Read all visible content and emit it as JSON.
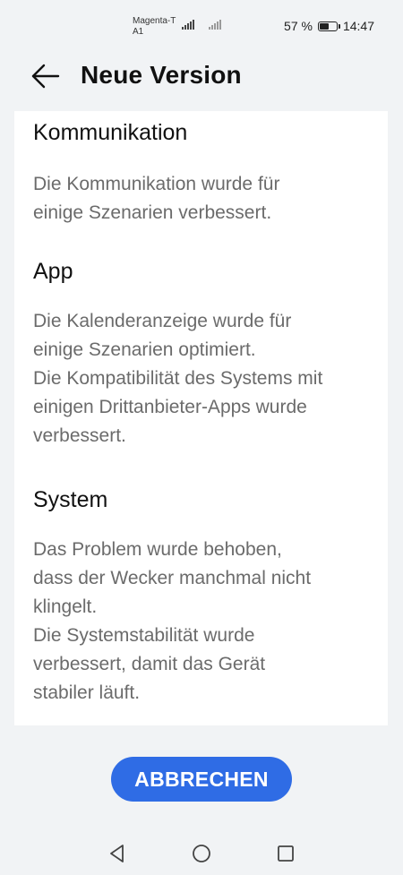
{
  "status_bar": {
    "carrier_line1": "Magenta-T",
    "carrier_line2": "A1",
    "battery_percent": "57 %",
    "battery_level": 0.57,
    "time": "14:47"
  },
  "header": {
    "back_icon": "arrow-left-icon",
    "title": "Neue Version"
  },
  "sections": [
    {
      "title": "Kommunikation",
      "lines": [
        "Die Kommunikation wurde für",
        "einige Szenarien verbessert."
      ]
    },
    {
      "title": "App",
      "lines": [
        "Die Kalenderanzeige wurde für",
        "einige Szenarien optimiert.",
        "Die Kompatibilität des Systems mit",
        "einigen Drittanbieter-Apps wurde",
        "verbessert."
      ]
    },
    {
      "title": "System",
      "lines": [
        "Das Problem wurde behoben,",
        "dass der Wecker manchmal nicht",
        "klingelt.",
        "Die Systemstabilität wurde",
        "verbessert, damit das Gerät",
        "stabiler läuft."
      ]
    }
  ],
  "actions": {
    "cancel_label": "ABBRECHEN"
  },
  "nav_bar": {
    "back_icon": "triangle-back-icon",
    "home_icon": "circle-home-icon",
    "recents_icon": "square-recents-icon"
  },
  "colors": {
    "background": "#f1f3f5",
    "card": "#ffffff",
    "accent": "#2f6ce5",
    "body_text": "#6b6b6b"
  }
}
